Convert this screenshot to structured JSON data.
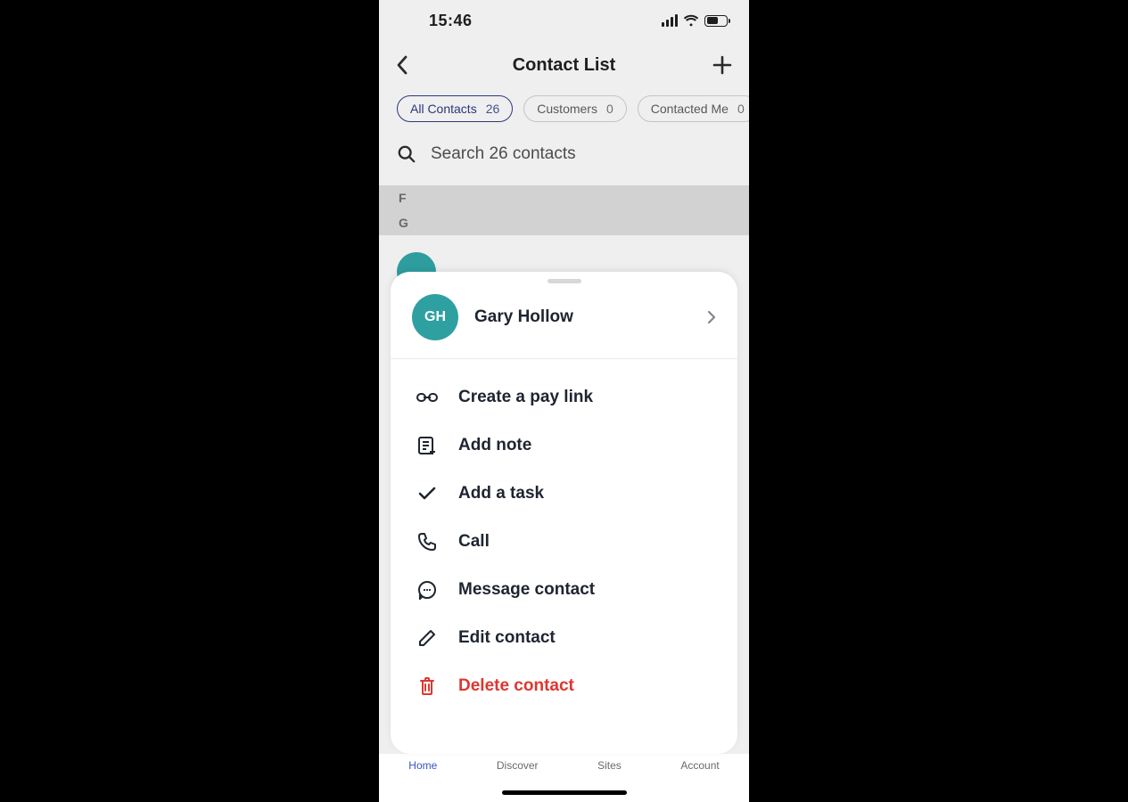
{
  "status": {
    "time": "15:46"
  },
  "header": {
    "title": "Contact List"
  },
  "filters": {
    "items": [
      {
        "label": "All Contacts",
        "count": "26",
        "active": true
      },
      {
        "label": "Customers",
        "count": "0",
        "active": false
      },
      {
        "label": "Contacted Me",
        "count": "0",
        "active": false
      }
    ]
  },
  "search": {
    "placeholder": "Search 26 contacts"
  },
  "sections": {
    "letters": [
      "F",
      "G"
    ]
  },
  "sheet": {
    "contact": {
      "initials": "GH",
      "name": "Gary Hollow"
    },
    "actions": {
      "paylink": "Create a pay link",
      "addnote": "Add note",
      "addtask": "Add a task",
      "call": "Call",
      "message": "Message contact",
      "edit": "Edit contact",
      "delete": "Delete contact"
    }
  },
  "tabs": {
    "items": [
      "Home",
      "Discover",
      "Sites",
      "Account"
    ]
  }
}
